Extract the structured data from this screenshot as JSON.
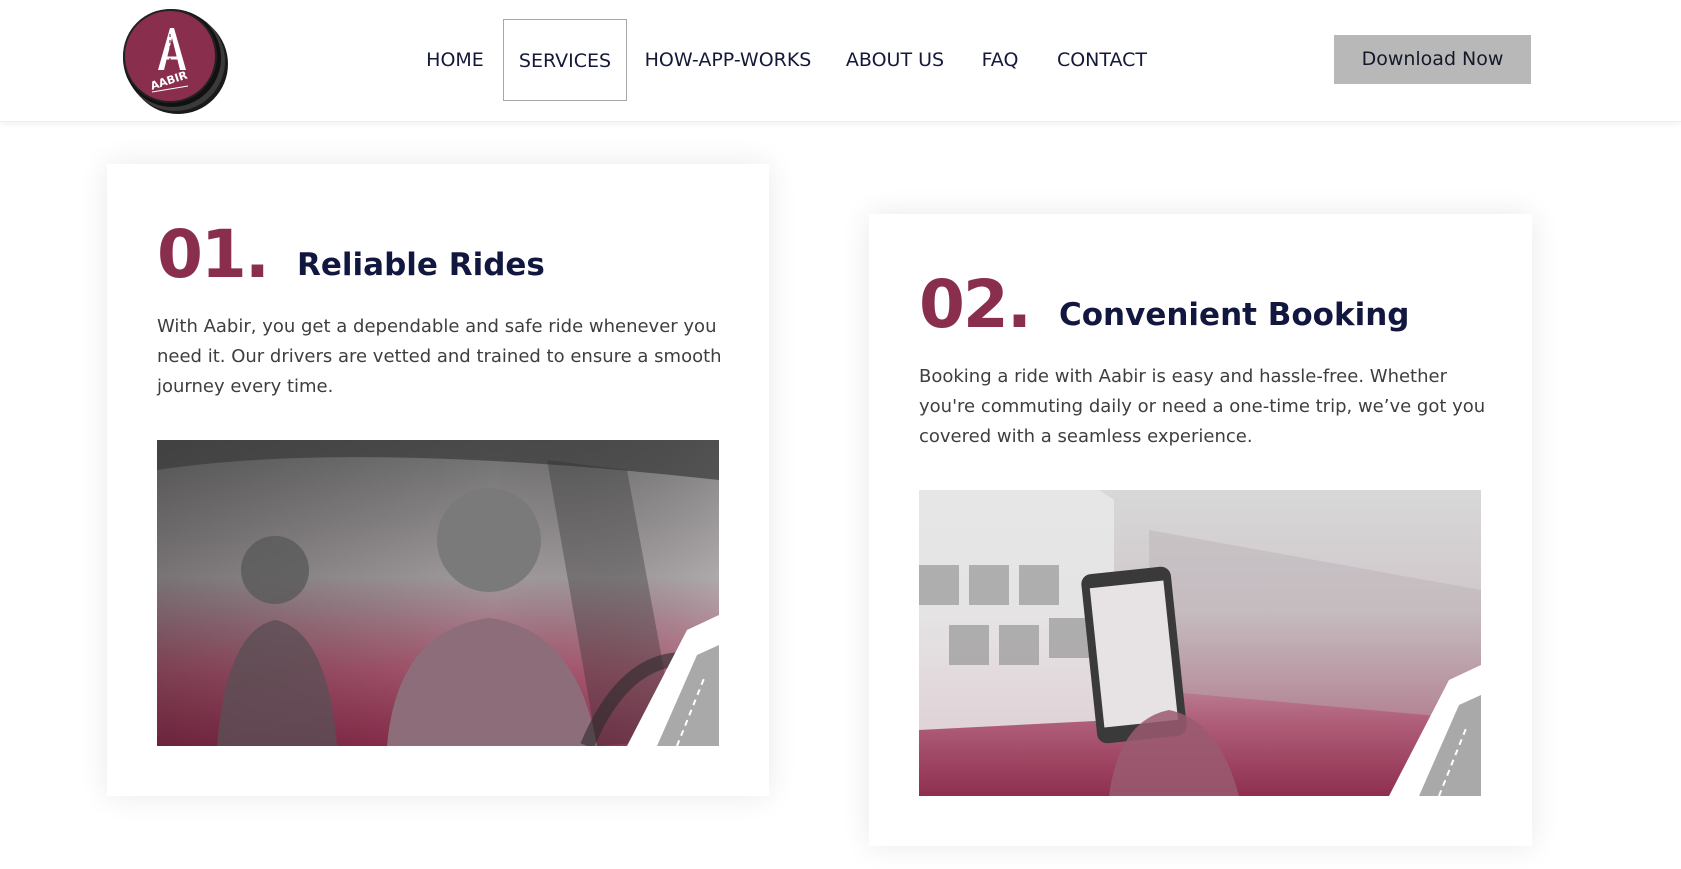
{
  "brand": {
    "logo_text": "AABIR",
    "accent_color": "#8a2e4e",
    "heading_color": "#12173f"
  },
  "nav": {
    "items": [
      {
        "label": "HOME",
        "active": false
      },
      {
        "label": "SERVICES",
        "active": true
      },
      {
        "label": "HOW-APP-WORKS",
        "active": false
      },
      {
        "label": "ABOUT US",
        "active": false
      },
      {
        "label": "FAQ",
        "active": false
      },
      {
        "label": "CONTACT",
        "active": false
      }
    ],
    "cta_label": "Download Now"
  },
  "services": [
    {
      "number": "01.",
      "title": "Reliable Rides",
      "body": "With Aabir, you get a dependable and safe ride whenever you need it. Our drivers are vetted and trained to ensure a smooth journey every time."
    },
    {
      "number": "02.",
      "title": "Convenient Booking",
      "body": "Booking a ride with Aabir is easy and hassle-free. Whether you're commuting daily or need a one-time trip, we’ve got you covered with a seamless experience."
    }
  ]
}
